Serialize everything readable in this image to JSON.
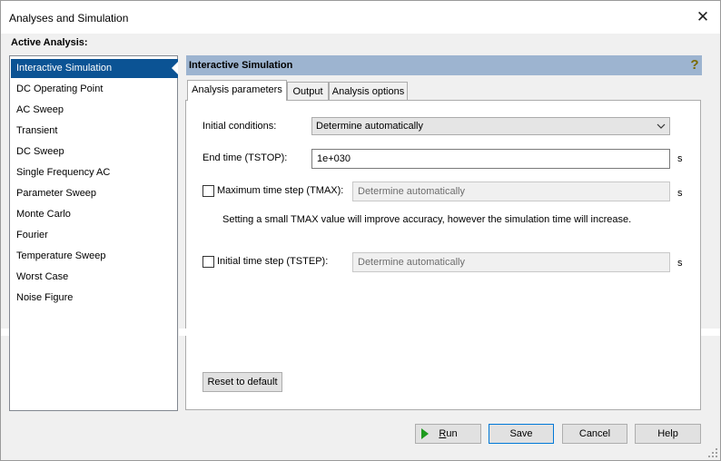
{
  "window": {
    "title": "Analyses and Simulation"
  },
  "sidebar": {
    "heading": "Active Analysis:",
    "items": [
      {
        "label": "Interactive Simulation",
        "selected": true
      },
      {
        "label": "DC Operating Point"
      },
      {
        "label": "AC Sweep"
      },
      {
        "label": "Transient"
      },
      {
        "label": "DC Sweep"
      },
      {
        "label": "Single Frequency AC"
      },
      {
        "label": "Parameter Sweep"
      },
      {
        "label": "Monte Carlo"
      },
      {
        "label": "Fourier"
      },
      {
        "label": "Temperature Sweep"
      },
      {
        "label": "Worst Case"
      },
      {
        "label": "Noise Figure"
      }
    ]
  },
  "panel": {
    "title": "Interactive Simulation",
    "help_icon": "question-mark-icon",
    "tabs": [
      {
        "label": "Analysis parameters",
        "active": true
      },
      {
        "label": "Output"
      },
      {
        "label": "Analysis options"
      }
    ],
    "initial_conditions": {
      "label": "Initial conditions:",
      "value": "Determine automatically"
    },
    "end_time": {
      "label": "End time (TSTOP):",
      "value": "1e+030",
      "unit": "s"
    },
    "max_time_step": {
      "label": "Maximum time step (TMAX):",
      "checked": false,
      "value": "Determine automatically",
      "unit": "s"
    },
    "note": "Setting a small TMAX value will improve accuracy, however the simulation time will increase.",
    "initial_time_step": {
      "label": "Initial time step (TSTEP):",
      "checked": false,
      "value": "Determine automatically",
      "unit": "s"
    },
    "reset_label": "Reset to default"
  },
  "footer": {
    "run_prefix": "R",
    "run_rest": "un",
    "save": "Save",
    "cancel": "Cancel",
    "help": "Help"
  },
  "colors": {
    "selection": "#0b5394",
    "header": "#9db4d0",
    "run_icon": "#1e9a1e"
  }
}
